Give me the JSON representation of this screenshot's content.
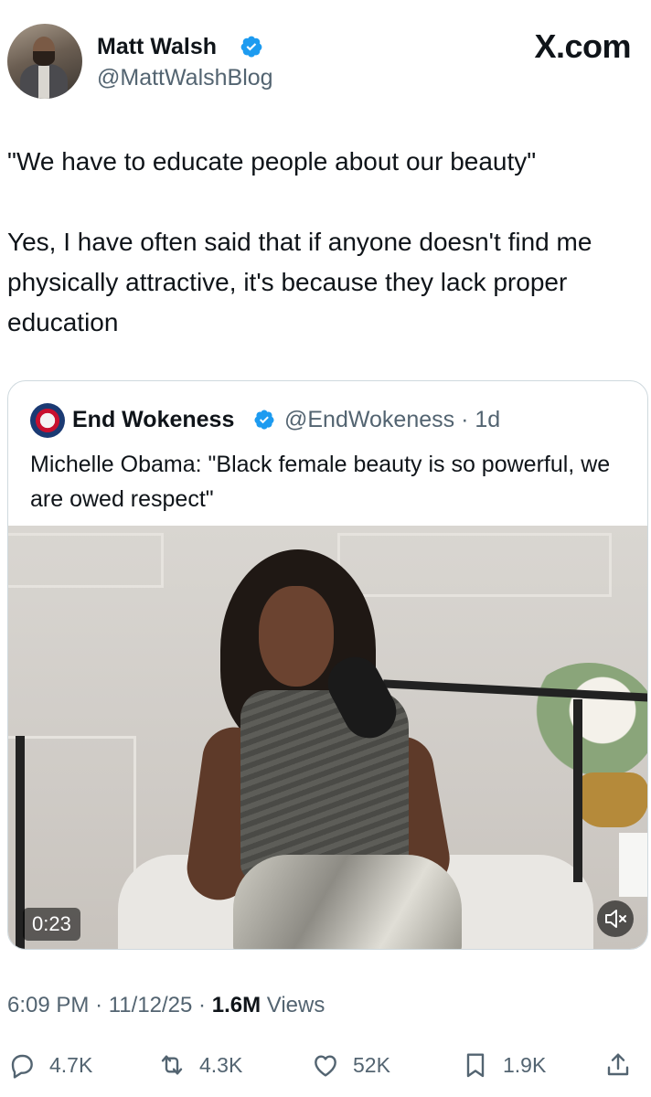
{
  "post": {
    "author_name": "Matt Walsh",
    "author_handle": "@MattWalshBlog",
    "site": "X.com",
    "text": "\"We have to educate people about our beauty\"\n\nYes, I have often said that if anyone doesn't find me physically attractive, it's because they lack proper education",
    "time": "6:09 PM",
    "date": "11/12/25",
    "views_count": "1.6M",
    "views_label": "Views",
    "separator": "·"
  },
  "quote": {
    "author_name": "End Wokeness",
    "author_handle": "@EndWokeness",
    "age": "1d",
    "separator": "·",
    "text": "Michelle Obama: \"Black female beauty is so powerful, we are owed respect\"",
    "video_duration": "0:23"
  },
  "actions": {
    "replies": "4.7K",
    "reposts": "4.3K",
    "likes": "52K",
    "bookmarks": "1.9K"
  },
  "colors": {
    "verified": "#1d9bf0",
    "secondary_text": "#536471",
    "border": "#cfd9de"
  },
  "icons": [
    "verified-badge-icon",
    "mute-icon",
    "reply-icon",
    "repost-icon",
    "like-icon",
    "bookmark-icon",
    "share-icon"
  ]
}
